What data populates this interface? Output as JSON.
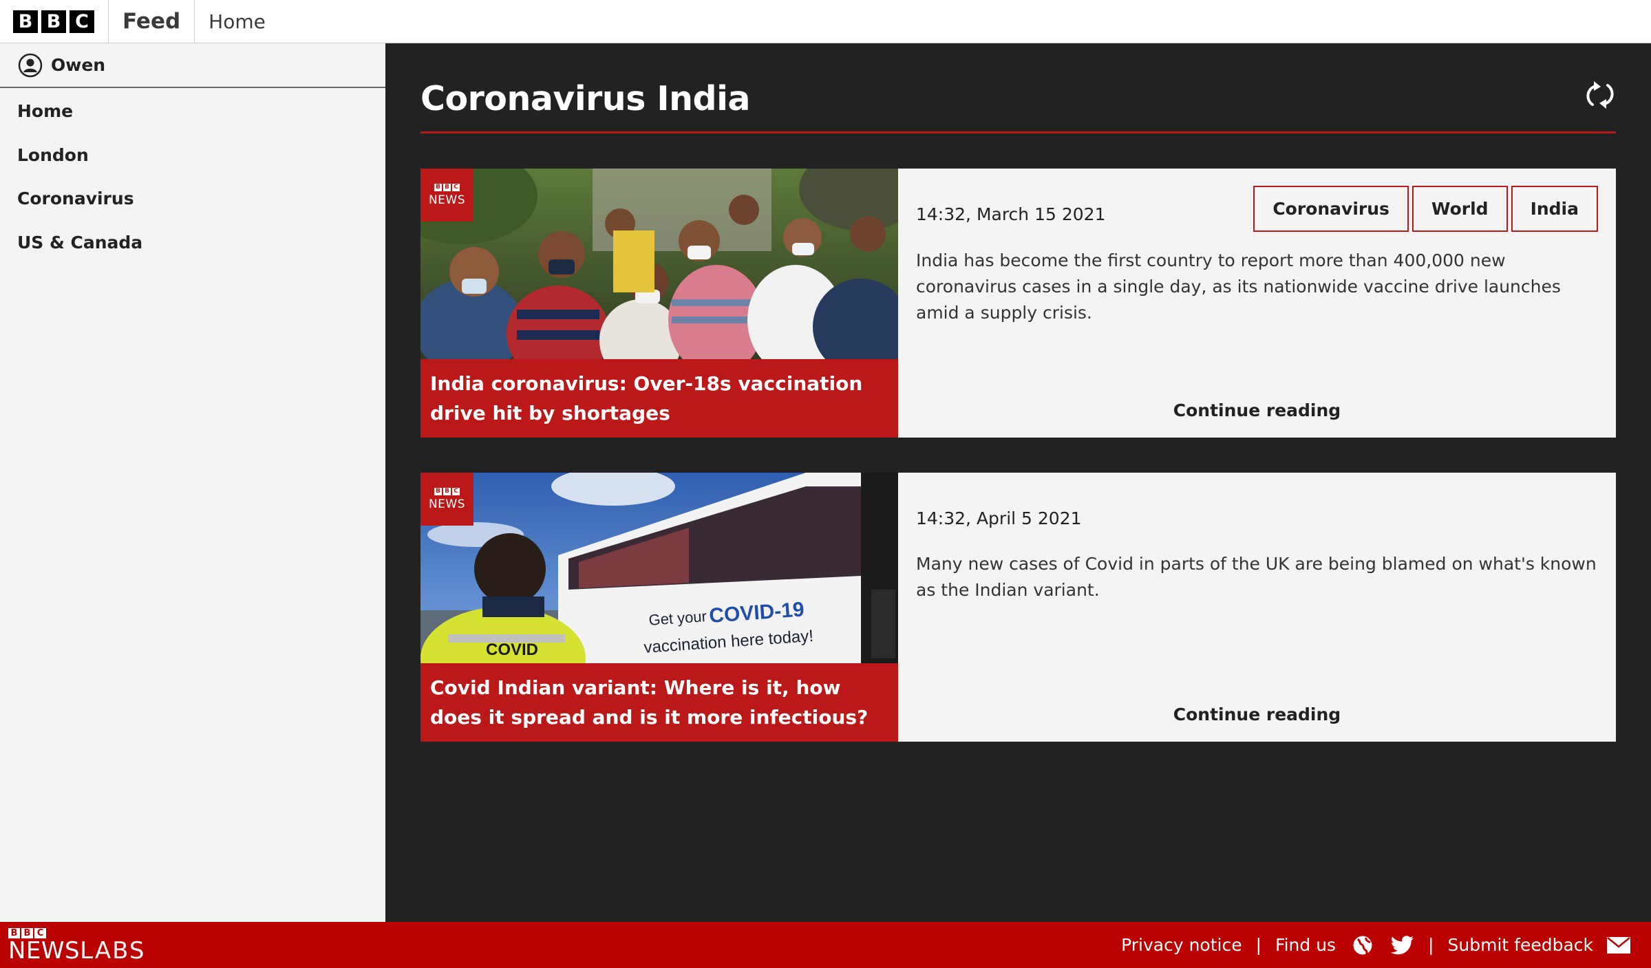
{
  "header": {
    "logo": [
      "B",
      "B",
      "C"
    ],
    "title": "Feed",
    "home_link": "Home"
  },
  "sidebar": {
    "user": "Owen",
    "items": [
      {
        "label": "Home"
      },
      {
        "label": "London"
      },
      {
        "label": "Coronavirus"
      },
      {
        "label": "US & Canada"
      }
    ]
  },
  "main": {
    "title": "Coronavirus India",
    "articles": [
      {
        "badge_brand": [
          "B",
          "B",
          "C"
        ],
        "badge_label": "NEWS",
        "headline": "India coronavirus: Over-18s vaccination drive hit by shortages",
        "timestamp": "14:32, March 15 2021",
        "tags": [
          "Coronavirus",
          "World",
          "India"
        ],
        "summary": "India has become the first country to report more than 400,000 new coronavirus cases in a single day, as its nationwide vaccine drive launches amid a supply crisis.",
        "continue": "Continue reading"
      },
      {
        "badge_brand": [
          "B",
          "B",
          "C"
        ],
        "badge_label": "NEWS",
        "headline": "Covid Indian variant: Where is it, how does it spread and is it more infectious?",
        "timestamp": "14:32, April 5 2021",
        "tags": [],
        "summary": "Many new cases of Covid in parts of the UK are being blamed on what's known as the Indian variant.",
        "continue": "Continue reading",
        "photo_text": {
          "vest": "COVID",
          "bus_line1": "Get your",
          "bus_highlight": "COVID-19",
          "bus_line2": "vaccination here today!"
        }
      }
    ]
  },
  "footer": {
    "logo_brand": [
      "B",
      "B",
      "C"
    ],
    "logo_news": "NEWS",
    "logo_labs": "LABS",
    "privacy": "Privacy notice",
    "sep1": "|",
    "find_us": "Find us",
    "sep2": "|",
    "feedback": "Submit feedback"
  },
  "colors": {
    "accent_red": "#bb1919",
    "footer_red": "#bb0000",
    "main_bg": "#222222",
    "sidebar_bg": "#f4f4f4"
  },
  "icons": [
    "user-icon",
    "refresh-icon",
    "globe-icon",
    "twitter-icon",
    "mail-icon"
  ]
}
